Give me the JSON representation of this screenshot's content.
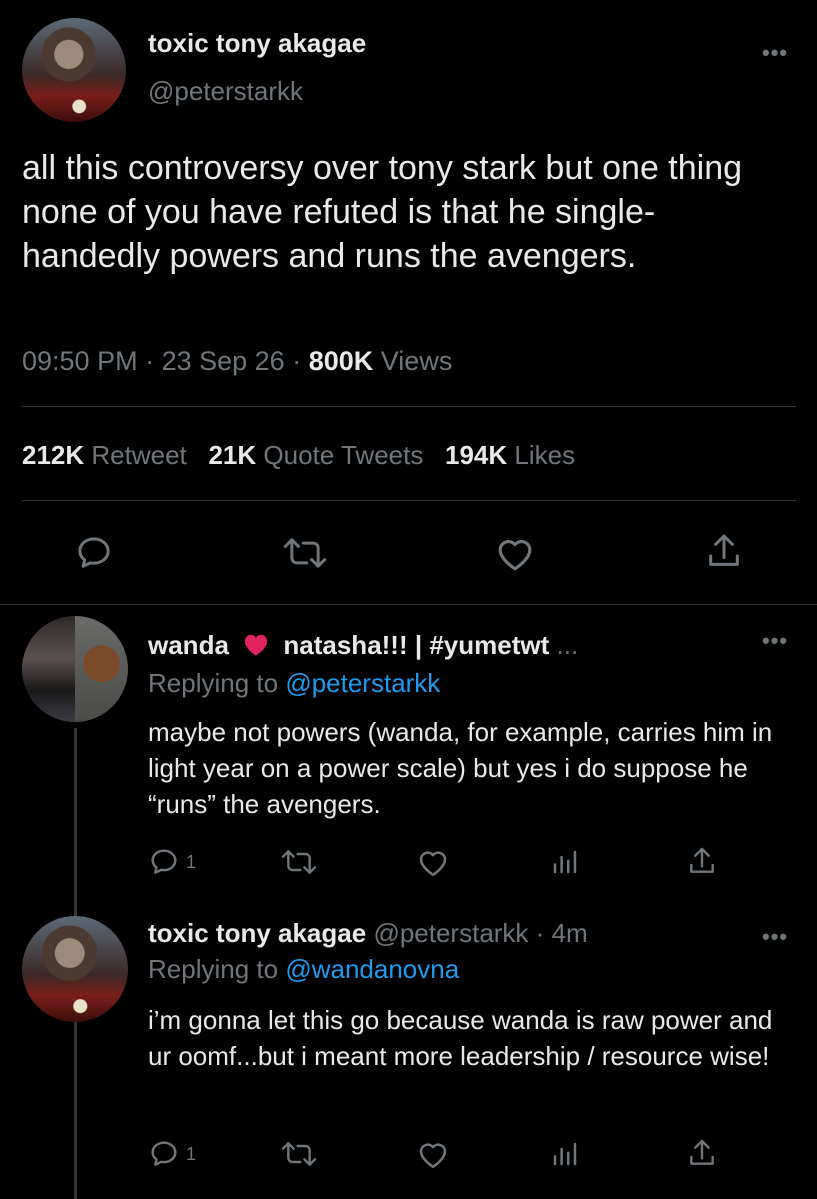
{
  "main_tweet": {
    "author_name": "toxic tony akagae",
    "handle": "@peterstarkk",
    "text": "all this controversy over tony stark but one thing none of you have refuted is that he single-handedly powers and runs the avengers.",
    "time": "09:50 PM",
    "date": "23 Sep 26",
    "views_count": "800K",
    "views_label": "Views",
    "more": "•••",
    "stats": {
      "retweets_count": "212K",
      "retweets_label": "Retweet",
      "quotes_count": "21K",
      "quotes_label": "Quote Tweets",
      "likes_count": "194K",
      "likes_label": "Likes"
    }
  },
  "replies": [
    {
      "author_name_1": "wanda",
      "author_name_2": "natasha!!! | #yumetwt",
      "ellipsis": "...",
      "replying_prefix": "Replying to",
      "replying_to": "@peterstarkk",
      "text": "maybe not powers (wanda, for example, carries him in light year on a power scale) but yes i do suppose he “runs” the avengers.",
      "reply_count": "1",
      "more": "•••"
    },
    {
      "author_name": "toxic tony akagae",
      "handle": "@peterstarkk",
      "time_ago": "4m",
      "replying_prefix": "Replying to",
      "replying_to": "@wandanovna",
      "text": "i’m gonna let this go because wanda is raw power and ur oomf...but i meant more leadership / resource wise!",
      "reply_count": "1",
      "more": "•••"
    }
  ],
  "icons": {
    "reply": "speech-bubble-icon",
    "retweet": "retweet-icon",
    "like": "heart-icon",
    "share": "share-icon",
    "analytics": "analytics-icon",
    "heart_emoji": "red-heart-icon"
  },
  "colors": {
    "background": "#000000",
    "text": "#e7e9ea",
    "muted": "#71767b",
    "link": "#1d9bf0",
    "divider": "#2f3336",
    "heart": "#e0245e"
  }
}
